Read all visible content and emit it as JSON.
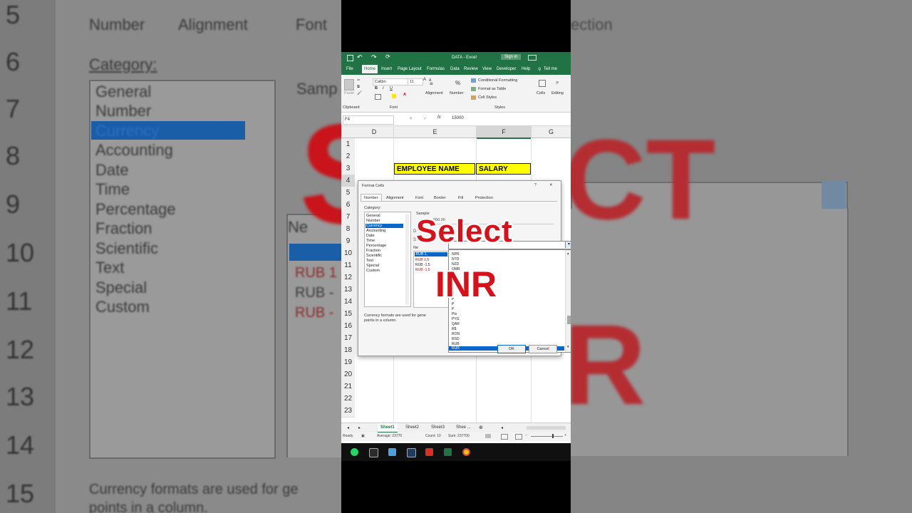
{
  "background": {
    "tabs": [
      "Number",
      "Alignment",
      "Font",
      "ection"
    ],
    "category_label": "Category:",
    "sample_label": "Samp",
    "categories": [
      "General",
      "Number",
      "Currency",
      "Accounting",
      "Date",
      "Time",
      "Percentage",
      "Fraction",
      "Scientific",
      "Text",
      "Special",
      "Custom"
    ],
    "row_numbers": [
      "5",
      "6",
      "7",
      "8",
      "9",
      "10",
      "11",
      "12",
      "13",
      "14",
      "15"
    ],
    "neg_label": "Ne",
    "neg_items": [
      "RUB 1",
      "RUB -",
      "RUB -"
    ],
    "footer": "Currency formats are used for ge",
    "footer2": "points in a column."
  },
  "window": {
    "title": "DATA - Excel",
    "sign_in": "Sign in"
  },
  "ribbon_tabs": [
    "File",
    "Home",
    "Insert",
    "Page Layout",
    "Formulas",
    "Data",
    "Review",
    "View",
    "Developer",
    "Help",
    "Tell me"
  ],
  "ribbon": {
    "font_name": "Calibri",
    "font_size": "11",
    "paste": "Paste",
    "clipboard": "Clipboard",
    "font": "Font",
    "alignment": "Alignment",
    "number": "Number",
    "conditional_formatting": "Conditional Formatting",
    "format_as_table": "Format as Table",
    "cell_styles": "Cell Styles",
    "styles": "Styles",
    "cells": "Cells",
    "editing": "Editing"
  },
  "formula_bar": {
    "name_box": "F4",
    "value": "15000"
  },
  "columns": [
    "D",
    "E",
    "F",
    "G"
  ],
  "rows": [
    "1",
    "2",
    "3",
    "4",
    "5",
    "6",
    "7",
    "8",
    "9",
    "10",
    "11",
    "12",
    "13",
    "14",
    "15",
    "16",
    "17",
    "18",
    "19",
    "20",
    "21",
    "22",
    "23"
  ],
  "table_header": {
    "employee_name": "EMPLOYEE NAME",
    "salary": "SALARY"
  },
  "dialog": {
    "title": "Format Cells",
    "help": "?",
    "close": "✕",
    "tabs": [
      "Number",
      "Alignment",
      "Font",
      "Border",
      "Fill",
      "Protection"
    ],
    "category_label": "Category:",
    "categories": [
      "General",
      "Number",
      "Currency",
      "Accounting",
      "Date",
      "Time",
      "Percentage",
      "Fraction",
      "Scientific",
      "Text",
      "Special",
      "Custom"
    ],
    "selected_category": "Currency",
    "sample_label": "Sample",
    "sample_value": "500.00",
    "neg_label": "Ne",
    "neg_items": [
      "-RUB 1,",
      "RUB 1,5",
      "RUB -1,5",
      "RUB -1,5"
    ],
    "description": "Currency formats are used for gene",
    "description2": "points in a column.",
    "ok": "OK",
    "cancel": "Cancel",
    "symbol_list": [
      "NPR",
      "NTD",
      "NZD",
      "OMR",
      "P",
      "P",
      "P",
      "P",
      "P",
      "P",
      "P",
      "P",
      "Pts",
      "PYG",
      "QAR",
      "R$",
      "RON",
      "RSD",
      "RUB",
      "RUR"
    ],
    "highlighted_symbol": "RUR"
  },
  "sheet_tabs": [
    "Sheet1",
    "Sheet2",
    "Sheet3",
    "Shee ..."
  ],
  "status": {
    "ready": "Ready",
    "average": "Average: 23770",
    "count": "Count: 10",
    "sum": "Sum: 237700"
  },
  "overlay": {
    "line1": "Select",
    "line2": "INR"
  },
  "colors": {
    "excel_green": "#217346",
    "header_yellow": "#ffff00",
    "overlay_red": "#d8101a",
    "selection_blue": "#0a66c8"
  }
}
